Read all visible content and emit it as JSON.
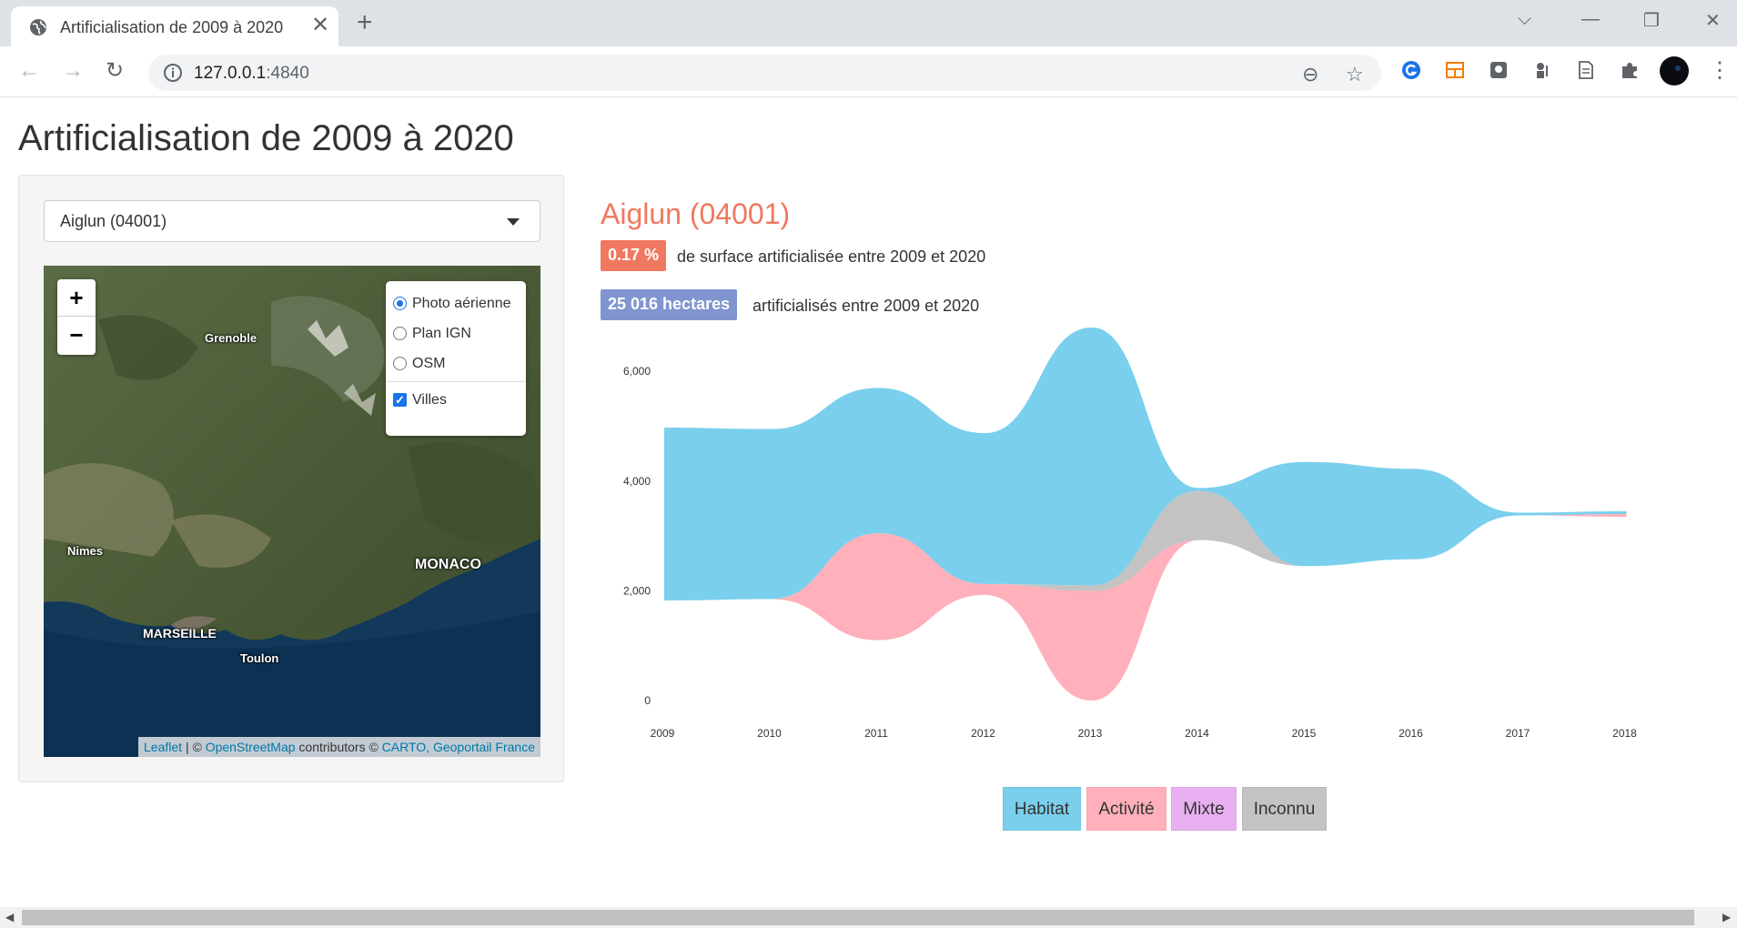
{
  "browser": {
    "tab_title": "Artificialisation de 2009 à 2020",
    "url_host": "127.0.0.1",
    "url_port": ":4840"
  },
  "page": {
    "title": "Artificialisation de 2009 à 2020"
  },
  "sidebar": {
    "select_value": "Aiglun (04001)",
    "map": {
      "zoom_in": "+",
      "zoom_out": "−",
      "layers": [
        "Photo aérienne",
        "Plan IGN",
        "OSM"
      ],
      "selected_layer": "Photo aérienne",
      "overlay": "Villes",
      "overlay_checked": true,
      "cities": [
        "Grenoble",
        "Nimes",
        "MONACO",
        "MARSEILLE",
        "Toulon"
      ],
      "attribution": {
        "leaflet": "Leaflet",
        "sep1": " | © ",
        "osm": "OpenStreetMap",
        "mid": " contributors © ",
        "carto": "CARTO, Geoportail France"
      }
    }
  },
  "main": {
    "commune": "Aiglun (04001)",
    "percent_badge": "0.17 %",
    "percent_text": "de surface artificialisée entre 2009 et 2020",
    "hectares_badge": "25 016 hectares",
    "hectares_text": "artificialisés entre 2009 et 2020"
  },
  "legend": [
    {
      "label": "Habitat",
      "color": "#7acfec"
    },
    {
      "label": "Activité",
      "color": "#ffb0ba"
    },
    {
      "label": "Mixte",
      "color": "#e8b0f0"
    },
    {
      "label": "Inconnu",
      "color": "#c3c3c3"
    }
  ],
  "colors": {
    "accent": "#f07860",
    "hectares_badge": "#8095d0",
    "habitat": "#7acfec",
    "activite": "#ffb0ba",
    "mixte": "#e8b0f0",
    "inconnu": "#c3c3c3"
  },
  "chart_data": {
    "type": "area",
    "subtype": "streamgraph",
    "x": [
      "2009",
      "2010",
      "2011",
      "2012",
      "2013",
      "2014",
      "2015",
      "2016",
      "2017",
      "2018"
    ],
    "y_ticks": [
      "0",
      "2,000",
      "4,000",
      "6,000"
    ],
    "ylim": [
      0,
      6800
    ],
    "series": [
      {
        "name": "Habitat",
        "values": [
          3150,
          3100,
          2650,
          2750,
          4700,
          50,
          1900,
          1650,
          50,
          50
        ]
      },
      {
        "name": "Activité",
        "values": [
          0,
          0,
          1950,
          200,
          2000,
          0,
          0,
          0,
          0,
          50
        ]
      },
      {
        "name": "Mixte",
        "values": [
          0,
          0,
          0,
          0,
          0,
          0,
          0,
          0,
          0,
          0
        ]
      },
      {
        "name": "Inconnu",
        "values": [
          0,
          0,
          0,
          0,
          100,
          900,
          0,
          0,
          0,
          0
        ]
      }
    ],
    "stream_center": [
      3400,
      3400,
      3400,
      3400,
      3400,
      3400,
      3400,
      3400,
      3400,
      3400
    ]
  }
}
